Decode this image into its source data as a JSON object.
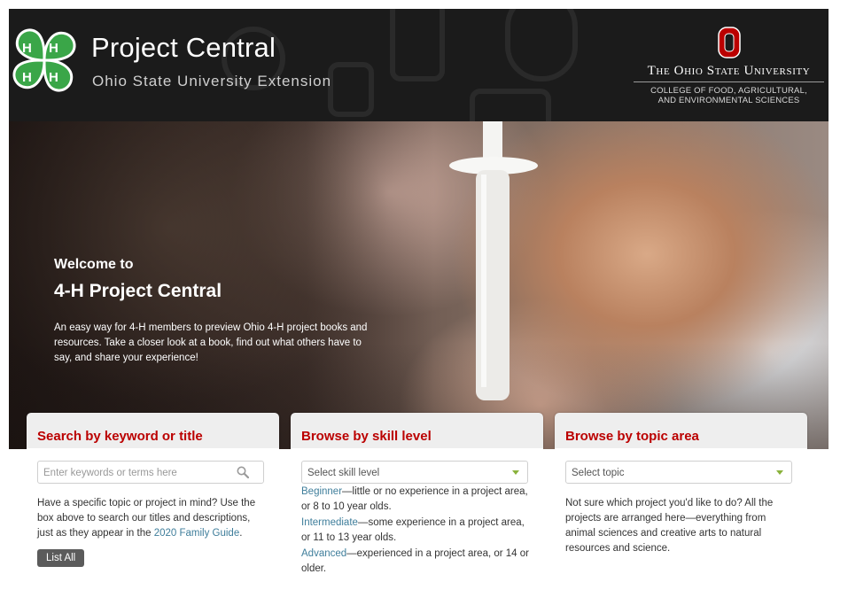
{
  "header": {
    "title": "Project Central",
    "subtitle": "Ohio State University Extension",
    "university_name": "The Ohio State University",
    "college_line1": "COLLEGE OF FOOD, AGRICULTURAL,",
    "college_line2": "AND ENVIRONMENTAL SCIENCES",
    "logo_icon": "four-h-clover-icon",
    "university_logo_icon": "block-o-icon"
  },
  "hero": {
    "kicker": "Welcome to",
    "title": "4-H Project Central",
    "description": "An easy way for 4-H members to preview Ohio 4-H project books and resources. Take a closer look at a book, find out what others have to say, and share your experience!"
  },
  "panels": {
    "search": {
      "heading": "Search by keyword or title",
      "placeholder": "Enter keywords or terms here",
      "value": "",
      "icon": "search-icon",
      "text_before_link": "Have a specific topic or project in mind? Use the box above to search our titles and descriptions, just as they appear in the ",
      "link_text": "2020 Family Guide",
      "text_after_link": ".",
      "button_label": "List All"
    },
    "skill": {
      "heading": "Browse by skill level",
      "select_value": "Select skill level",
      "levels": [
        {
          "name": "Beginner",
          "desc": "—little or no experience in a project area, or 8 to 10 year olds."
        },
        {
          "name": "Intermediate",
          "desc": "—some experience in a project area, or 11 to 13 year olds."
        },
        {
          "name": "Advanced",
          "desc": "—experienced in a project area, or 14 or older."
        }
      ]
    },
    "topic": {
      "heading": "Browse by topic area",
      "select_value": "Select topic",
      "text": "Not sure which project you'd like to do? All the projects are arranged here—everything from animal sciences and creative arts to natural resources and science."
    }
  },
  "colors": {
    "header_bg": "#1b1b1b",
    "accent_red": "#bb0000",
    "link": "#3f7e9b",
    "button_bg": "#5b5b5b",
    "clover_green": "#3aa648",
    "select_caret": "#8ab23c"
  }
}
